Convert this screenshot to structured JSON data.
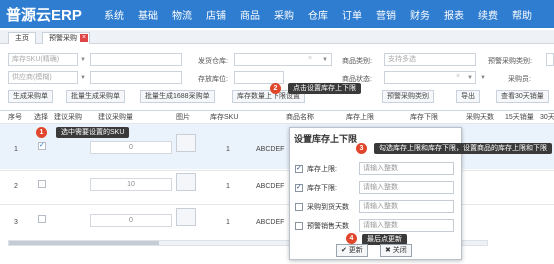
{
  "app": {
    "brand": "普源云ERP",
    "nav": [
      "系统",
      "基础",
      "物流",
      "店铺",
      "商品",
      "采购",
      "仓库",
      "订单",
      "营销",
      "财务",
      "报表",
      "续费",
      "帮助"
    ]
  },
  "tabs": {
    "home": "主页",
    "current": "预警采购",
    "close": "×"
  },
  "filters": {
    "sku_placeholder": "库存SKU(精确)",
    "supplier_placeholder": "供应商(模糊)",
    "warehouse_label": "发货仓库:",
    "location_label": "存放库位:",
    "category_label": "商品类别:",
    "category_placeholder": "支持多选",
    "status_label": "商品状态:",
    "warn_type_label": "预警采购类别:",
    "buyer_label": "采购员:",
    "clear": "×",
    "caret": "▼"
  },
  "toolbar": {
    "buttons": [
      "生成采购单",
      "批量生成采购单",
      "批量生成1688采购单",
      "库存数量上下限设置",
      "预警采购类别",
      "导出",
      "查看30天销量"
    ]
  },
  "table": {
    "headers": [
      "序号",
      "选择",
      "建议采购",
      "建议采购量",
      "图片",
      "库存SKU",
      "商品名称",
      "库存上限",
      "库存下限",
      "采购天数",
      "15天销量",
      "30天"
    ],
    "rows": [
      {
        "index": "1",
        "checked": true,
        "suggest": "0",
        "stock_sku": "1",
        "name": "ABCDEF"
      },
      {
        "index": "2",
        "checked": false,
        "suggest": "10",
        "stock_sku": "1",
        "name": "ABCDEF"
      },
      {
        "index": "3",
        "checked": false,
        "suggest": "0",
        "stock_sku": "1",
        "name": "ABCDEF"
      }
    ]
  },
  "tips": {
    "t1": "选中需要设置的SKU",
    "t2": "点击设置库存上下限",
    "t3": "勾选库存上限和库存下限，设置商品的库存上限和下限",
    "t4": "最后点更新"
  },
  "badges": {
    "b1": "1",
    "b2": "2",
    "b3": "3",
    "b4": "4"
  },
  "modal": {
    "title": "设置库存上下限",
    "fields": [
      {
        "label": "库存上限:",
        "placeholder": "请输入整数",
        "checked": true
      },
      {
        "label": "库存下限:",
        "placeholder": "请输入整数",
        "checked": true
      },
      {
        "label": "采购到货天数",
        "placeholder": "请输入整数",
        "checked": false
      },
      {
        "label": "预警销售天数",
        "placeholder": "请输入整数",
        "checked": false
      }
    ],
    "update": "✔ 更新",
    "close": "✖ 关闭"
  }
}
